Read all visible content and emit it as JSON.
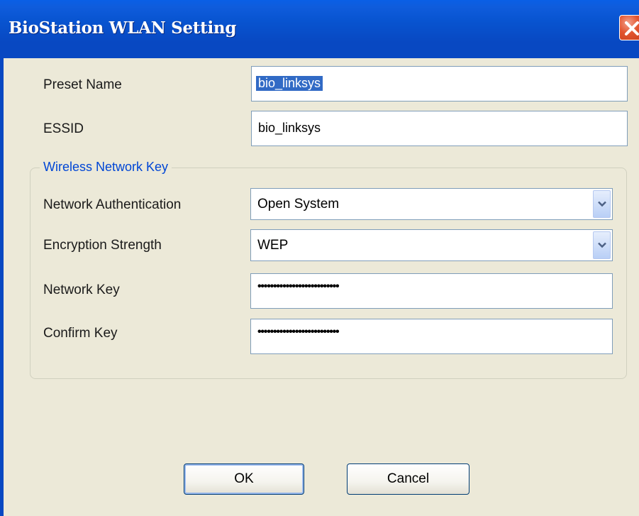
{
  "window": {
    "title": "BioStation WLAN Setting"
  },
  "form": {
    "preset_name_label": "Preset Name",
    "preset_name_value": "bio_linksys",
    "essid_label": "ESSID",
    "essid_value": "bio_linksys"
  },
  "group": {
    "legend": "Wireless Network Key",
    "auth_label": "Network Authentication",
    "auth_value": "Open System",
    "encryption_label": "Encryption Strength",
    "encryption_value": "WEP",
    "network_key_label": "Network Key",
    "network_key_masked": "••••••••••••••••••••••••••",
    "confirm_key_label": "Confirm Key",
    "confirm_key_masked": "••••••••••••••••••••••••••"
  },
  "buttons": {
    "ok": "OK",
    "cancel": "Cancel"
  },
  "icons": {
    "close": "close-x-icon",
    "dropdown": "chevron-down-icon"
  },
  "colors": {
    "titlebar": "#0848C2",
    "dialog_bg": "#ECE9D8",
    "legend_text": "#0046D5",
    "close_red": "#D8502B",
    "selection": "#316AC5"
  }
}
